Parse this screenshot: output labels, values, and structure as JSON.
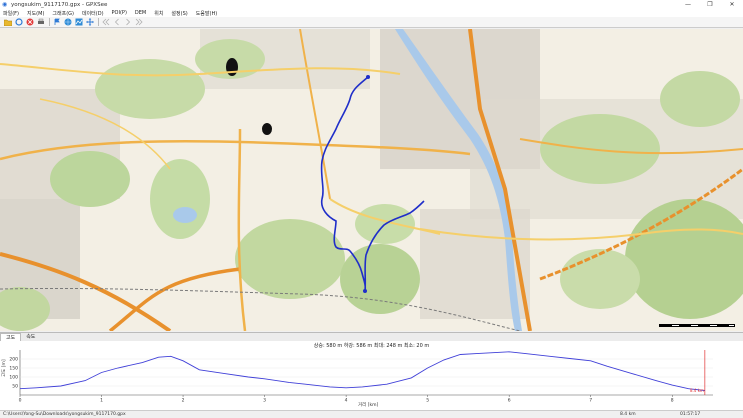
{
  "window": {
    "title": "yongsukim_9117170.gpx - GPXSee",
    "app_icon": "gpxsee-icon",
    "controls": [
      "—",
      "❐",
      "✕"
    ]
  },
  "menu": [
    "파일(F)",
    "지도(M)",
    "그래프(G)",
    "데이터(D)",
    "POI(P)",
    "DEM",
    "위치",
    "설정(S)",
    "도움말(H)"
  ],
  "toolbar": {
    "buttons": [
      "open-icon",
      "reload-icon",
      "close-icon",
      "print-icon",
      "poi-icon",
      "map-icon",
      "graph-icon",
      "fullscreen-icon",
      "first-icon",
      "prev-icon",
      "next-icon",
      "last-icon"
    ]
  },
  "tabs": [
    "고도",
    "속도"
  ],
  "elevation": {
    "stats": "상승: 580 m  하강: 586 m  최대: 248 m  최소: 20 m",
    "y_label": "고도 [m]",
    "x_label": "거리 [km]",
    "y_ticks": [
      "200",
      "150",
      "100",
      "50"
    ],
    "x_ticks": [
      "0",
      "1",
      "2",
      "3",
      "4",
      "5",
      "6",
      "7",
      "8"
    ],
    "end_marker": "8.4 km",
    "line_color": "#4040d8"
  },
  "chart_data": {
    "type": "line",
    "x": [
      0,
      0.2,
      0.5,
      0.8,
      1.0,
      1.2,
      1.5,
      1.7,
      1.85,
      2.0,
      2.2,
      2.5,
      2.8,
      3.0,
      3.3,
      3.5,
      3.8,
      4.0,
      4.2,
      4.5,
      4.8,
      5.0,
      5.2,
      5.4,
      5.6,
      5.8,
      6.0,
      6.2,
      6.5,
      6.8,
      7.0,
      7.2,
      7.5,
      7.8,
      8.0,
      8.2,
      8.4
    ],
    "y": [
      35,
      40,
      50,
      80,
      125,
      150,
      180,
      210,
      215,
      190,
      140,
      120,
      100,
      90,
      70,
      60,
      45,
      40,
      45,
      60,
      95,
      150,
      195,
      225,
      230,
      235,
      240,
      230,
      215,
      200,
      190,
      160,
      120,
      80,
      55,
      35,
      25
    ],
    "xlabel": "거리 [km]",
    "ylabel": "고도 [m]",
    "xlim": [
      0,
      8.4
    ],
    "ylim": [
      0,
      250
    ]
  },
  "status": {
    "path": "C:\\Users\\Yong-Su\\Downloads\\yongsukim_9117170.gpx",
    "distance": "8.4 km",
    "time": "01:57:17"
  }
}
